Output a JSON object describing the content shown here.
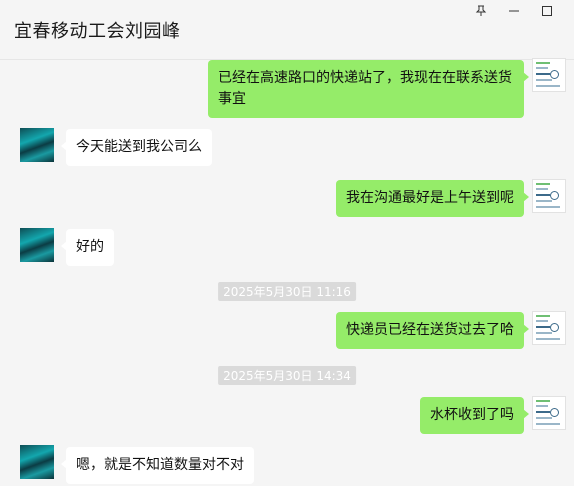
{
  "window": {
    "title": "宜春移动工会刘园峰",
    "controls": {
      "pin": "pin-icon",
      "minimize": "minimize-icon",
      "maximize": "maximize-icon"
    }
  },
  "messages": [
    {
      "side": "self",
      "text": "已经在高速路口的快递站了，我现在在联系送货事宜"
    },
    {
      "side": "other",
      "text": "今天能送到我公司么"
    },
    {
      "side": "self",
      "text": "我在沟通最好是上午送到呢"
    },
    {
      "side": "other",
      "text": "好的"
    },
    {
      "timestamp": "2025年5月30日 11:16"
    },
    {
      "side": "self",
      "text": "快递员已经在送货过去了哈"
    },
    {
      "timestamp": "2025年5月30日 14:34"
    },
    {
      "side": "self",
      "text": "水杯收到了吗"
    },
    {
      "side": "other",
      "text": "嗯，就是不知道数量对不对"
    }
  ],
  "m": {
    "m1a": "已经在高速路口的快递站了，我现在在联系送货",
    "m1b": "事宜",
    "m2": "今天能送到我公司么",
    "m3": "我在沟通最好是上午送到呢",
    "m4": "好的",
    "t1": "2025年5月30日 11:16",
    "m5": "快递员已经在送货过去了哈",
    "t2": "2025年5月30日 14:34",
    "m6": "水杯收到了吗",
    "m7": "嗯，就是不知道数量对不对"
  },
  "colors": {
    "self_bubble": "#95ec69",
    "other_bubble": "#ffffff",
    "background": "#f5f5f5",
    "timestamp_bg": "#dadada"
  }
}
